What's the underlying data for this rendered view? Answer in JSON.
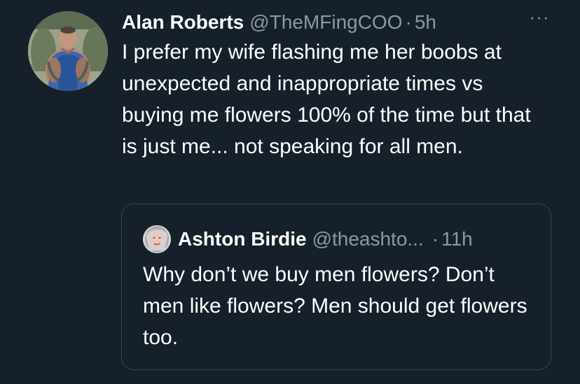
{
  "tweet": {
    "display_name": "Alan Roberts",
    "handle": "@TheMFingCOO",
    "separator": "·",
    "time": "5h",
    "more_label": "···",
    "text": "I prefer my wife flashing me her boobs at unexpected and inappropriate times vs buying me flowers 100% of the time but that is just me... not speaking for all men."
  },
  "quoted_tweet": {
    "display_name": "Ashton Birdie",
    "handle": "@theashto...",
    "separator": "·",
    "time": "11h",
    "text": "Why don’t we buy men flowers? Don’t men like flowers? Men should get flowers too."
  },
  "colors": {
    "background": "#15202b",
    "primary_text": "#ffffff",
    "secondary_text": "#8b98a5",
    "border": "#38444d"
  },
  "icons": {
    "more": "more-horizontal-icon"
  }
}
